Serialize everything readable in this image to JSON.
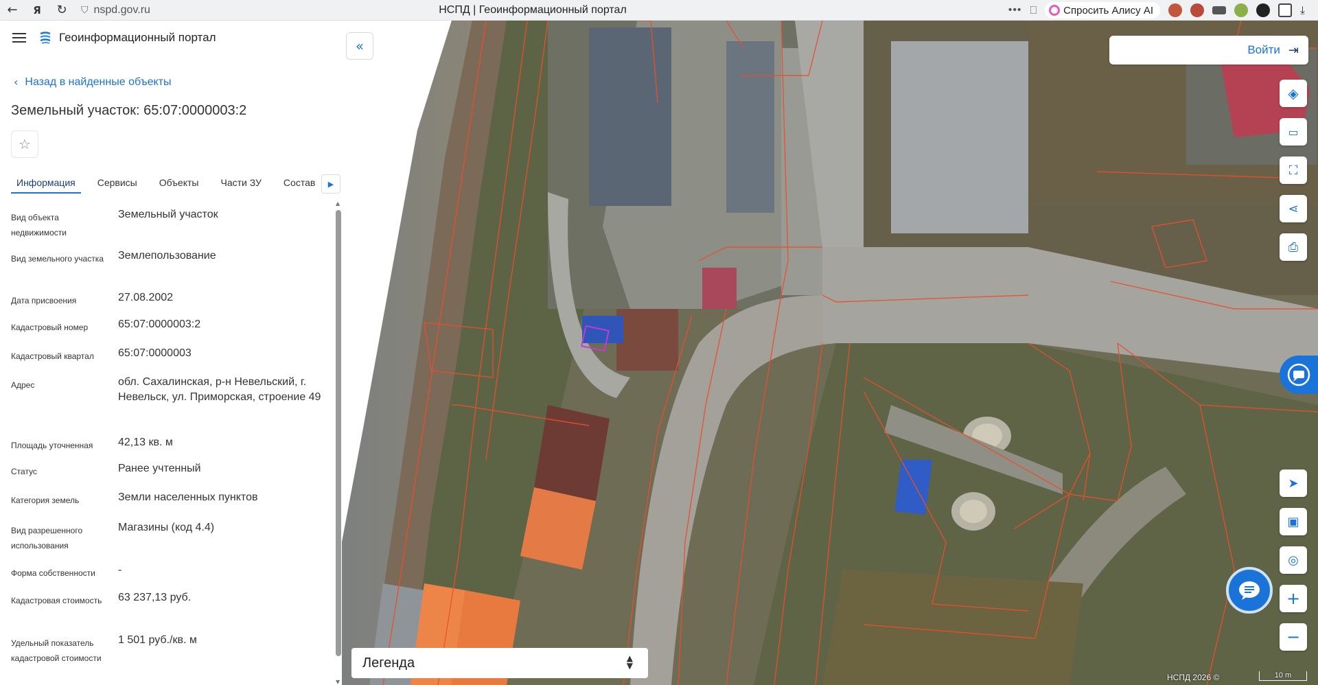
{
  "browser": {
    "url": "nspd.gov.ru",
    "tab_title": "НСПД | Геоинформационный портал",
    "alice_label": "Спросить Алису AI"
  },
  "app": {
    "title": "Геоинформационный портал",
    "back_label": "Назад в найденные объекты",
    "object_title": "Земельный участок: 65:07:0000003:2"
  },
  "tabs": [
    {
      "label": "Информация",
      "active": true
    },
    {
      "label": "Сервисы",
      "active": false
    },
    {
      "label": "Объекты",
      "active": false
    },
    {
      "label": "Части ЗУ",
      "active": false
    },
    {
      "label": "Состав",
      "active": false
    }
  ],
  "properties": [
    {
      "label": "Вид объекта недвижимости",
      "value": "Земельный участок"
    },
    {
      "label": "Вид земельного участка",
      "value": "Землепользование"
    },
    {
      "label": "Дата присвоения",
      "value": "27.08.2002"
    },
    {
      "label": "Кадастровый номер",
      "value": "65:07:0000003:2"
    },
    {
      "label": "Кадастровый квартал",
      "value": "65:07:0000003"
    },
    {
      "label": "Адрес",
      "value": "обл. Сахалинская, р-н Невельский, г. Невельск, ул. Приморская, строение 49"
    },
    {
      "label": "Площадь уточненная",
      "value": "42,13 кв. м"
    },
    {
      "label": "Статус",
      "value": "Ранее учтенный"
    },
    {
      "label": "Категория земель",
      "value": "Земли населенных пунктов"
    },
    {
      "label": "Вид разрешенного использования",
      "value": "Магазины (код 4.4)"
    },
    {
      "label": "Форма собственности",
      "value": "-"
    },
    {
      "label": "Кадастровая стоимость",
      "value": "63 237,13 руб."
    },
    {
      "label": "Удельный показатель кадастровой стоимости",
      "value": "1 501 руб./кв. м"
    }
  ],
  "map": {
    "login_label": "Войти",
    "legend_label": "Легенда",
    "copyright": "НСПД 2026 ©",
    "scale_label": "10 m"
  },
  "colors": {
    "accent": "#1a73d9",
    "parcel_border": "#e8502a",
    "selected_parcel": "#c23bd0"
  }
}
